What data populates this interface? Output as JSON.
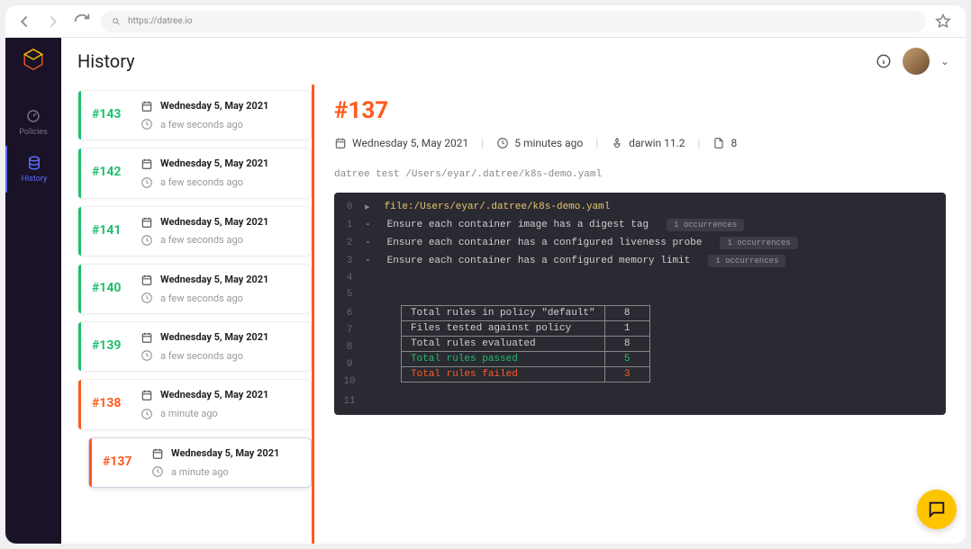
{
  "browser": {
    "url": "https://datree.io"
  },
  "sidebar": {
    "items": [
      {
        "label": "Policies"
      },
      {
        "label": "History"
      }
    ]
  },
  "page": {
    "title": "History"
  },
  "history": [
    {
      "id": "#143",
      "date": "Wednesday 5, May 2021",
      "ago": "a few seconds ago",
      "status": "green"
    },
    {
      "id": "#142",
      "date": "Wednesday 5, May 2021",
      "ago": "a few seconds ago",
      "status": "green"
    },
    {
      "id": "#141",
      "date": "Wednesday 5, May 2021",
      "ago": "a few seconds ago",
      "status": "green"
    },
    {
      "id": "#140",
      "date": "Wednesday 5, May 2021",
      "ago": "a few seconds ago",
      "status": "green"
    },
    {
      "id": "#139",
      "date": "Wednesday 5, May 2021",
      "ago": "a few seconds ago",
      "status": "green"
    },
    {
      "id": "#138",
      "date": "Wednesday 5, May 2021",
      "ago": "a minute ago",
      "status": "orange"
    },
    {
      "id": "#137",
      "date": "Wednesday 5, May 2021",
      "ago": "a minute ago",
      "status": "orange",
      "selected": true
    }
  ],
  "detail": {
    "id": "#137",
    "date": "Wednesday 5, May 2021",
    "ago": "5 minutes ago",
    "platform": "darwin 11.2",
    "count": "8",
    "command": "datree test /Users/eyar/.datree/k8s-demo.yaml",
    "file_line": "file:/Users/eyar/.datree/k8s-demo.yaml",
    "rules": [
      {
        "text": "Ensure each container image has a digest tag",
        "occurrences": "1 occurrences"
      },
      {
        "text": "Ensure each container has a configured liveness probe",
        "occurrences": "1 occurrences"
      },
      {
        "text": "Ensure each container has a configured memory limit",
        "occurrences": "1 occurrences"
      }
    ],
    "summary": [
      {
        "label": "Total rules in policy \"default\"",
        "value": "8",
        "cls": ""
      },
      {
        "label": "Files tested against policy",
        "value": "1",
        "cls": ""
      },
      {
        "label": "Total rules evaluated",
        "value": "8",
        "cls": ""
      },
      {
        "label": "Total rules passed",
        "value": "5",
        "cls": "passed"
      },
      {
        "label": "Total rules failed",
        "value": "3",
        "cls": "failed"
      }
    ],
    "gutters": [
      "0",
      "1",
      "2",
      "3",
      "4",
      "5",
      "6",
      "7",
      "8",
      "9",
      "10",
      "11"
    ]
  }
}
